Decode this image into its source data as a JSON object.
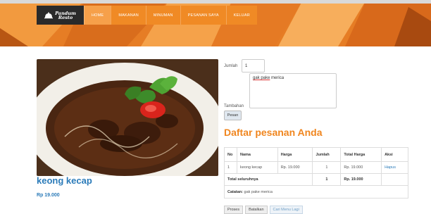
{
  "brand": {
    "line1": "Pandum",
    "line2": "Resto",
    "icon": "cloche-icon"
  },
  "nav": {
    "items": [
      {
        "label": "HOME",
        "active": true
      },
      {
        "label": "MAKANAN",
        "active": false
      },
      {
        "label": "MINUMAN",
        "active": false
      },
      {
        "label": "PESANAN SAYA",
        "active": false
      },
      {
        "label": "KELUAR",
        "active": false
      }
    ]
  },
  "product": {
    "name": "keong kecap",
    "price": "Rp 19.000"
  },
  "form": {
    "qty_label": "Jumlah",
    "qty_value": "1",
    "note_label": "Tambahan",
    "note_value_word": "gak pake",
    "note_value_rest": " merica",
    "submit_label": "Pesan"
  },
  "orders": {
    "heading": "Daftar pesanan Anda",
    "columns": [
      "No",
      "Nama",
      "Harga",
      "Jumlah",
      "Total Harga",
      "Aksi"
    ],
    "rows": [
      {
        "no": "1",
        "name": "keong kecap",
        "price": "Rp. 19.000",
        "qty": "1",
        "total": "Rp. 19.000",
        "action": "Hapus"
      }
    ],
    "total_label": "Total seluruhnya",
    "total_qty": "1",
    "total_amount": "Rp. 19.000",
    "note_label": "Catatan:",
    "note_value": "gak pake merica"
  },
  "actions": {
    "process": "Proses",
    "cancel": "Batalkan",
    "more": "Cari Menu Lagi"
  },
  "colors": {
    "accent": "#f0861f",
    "link": "#2b7bb9",
    "brand_bg": "#2a2a2a"
  }
}
